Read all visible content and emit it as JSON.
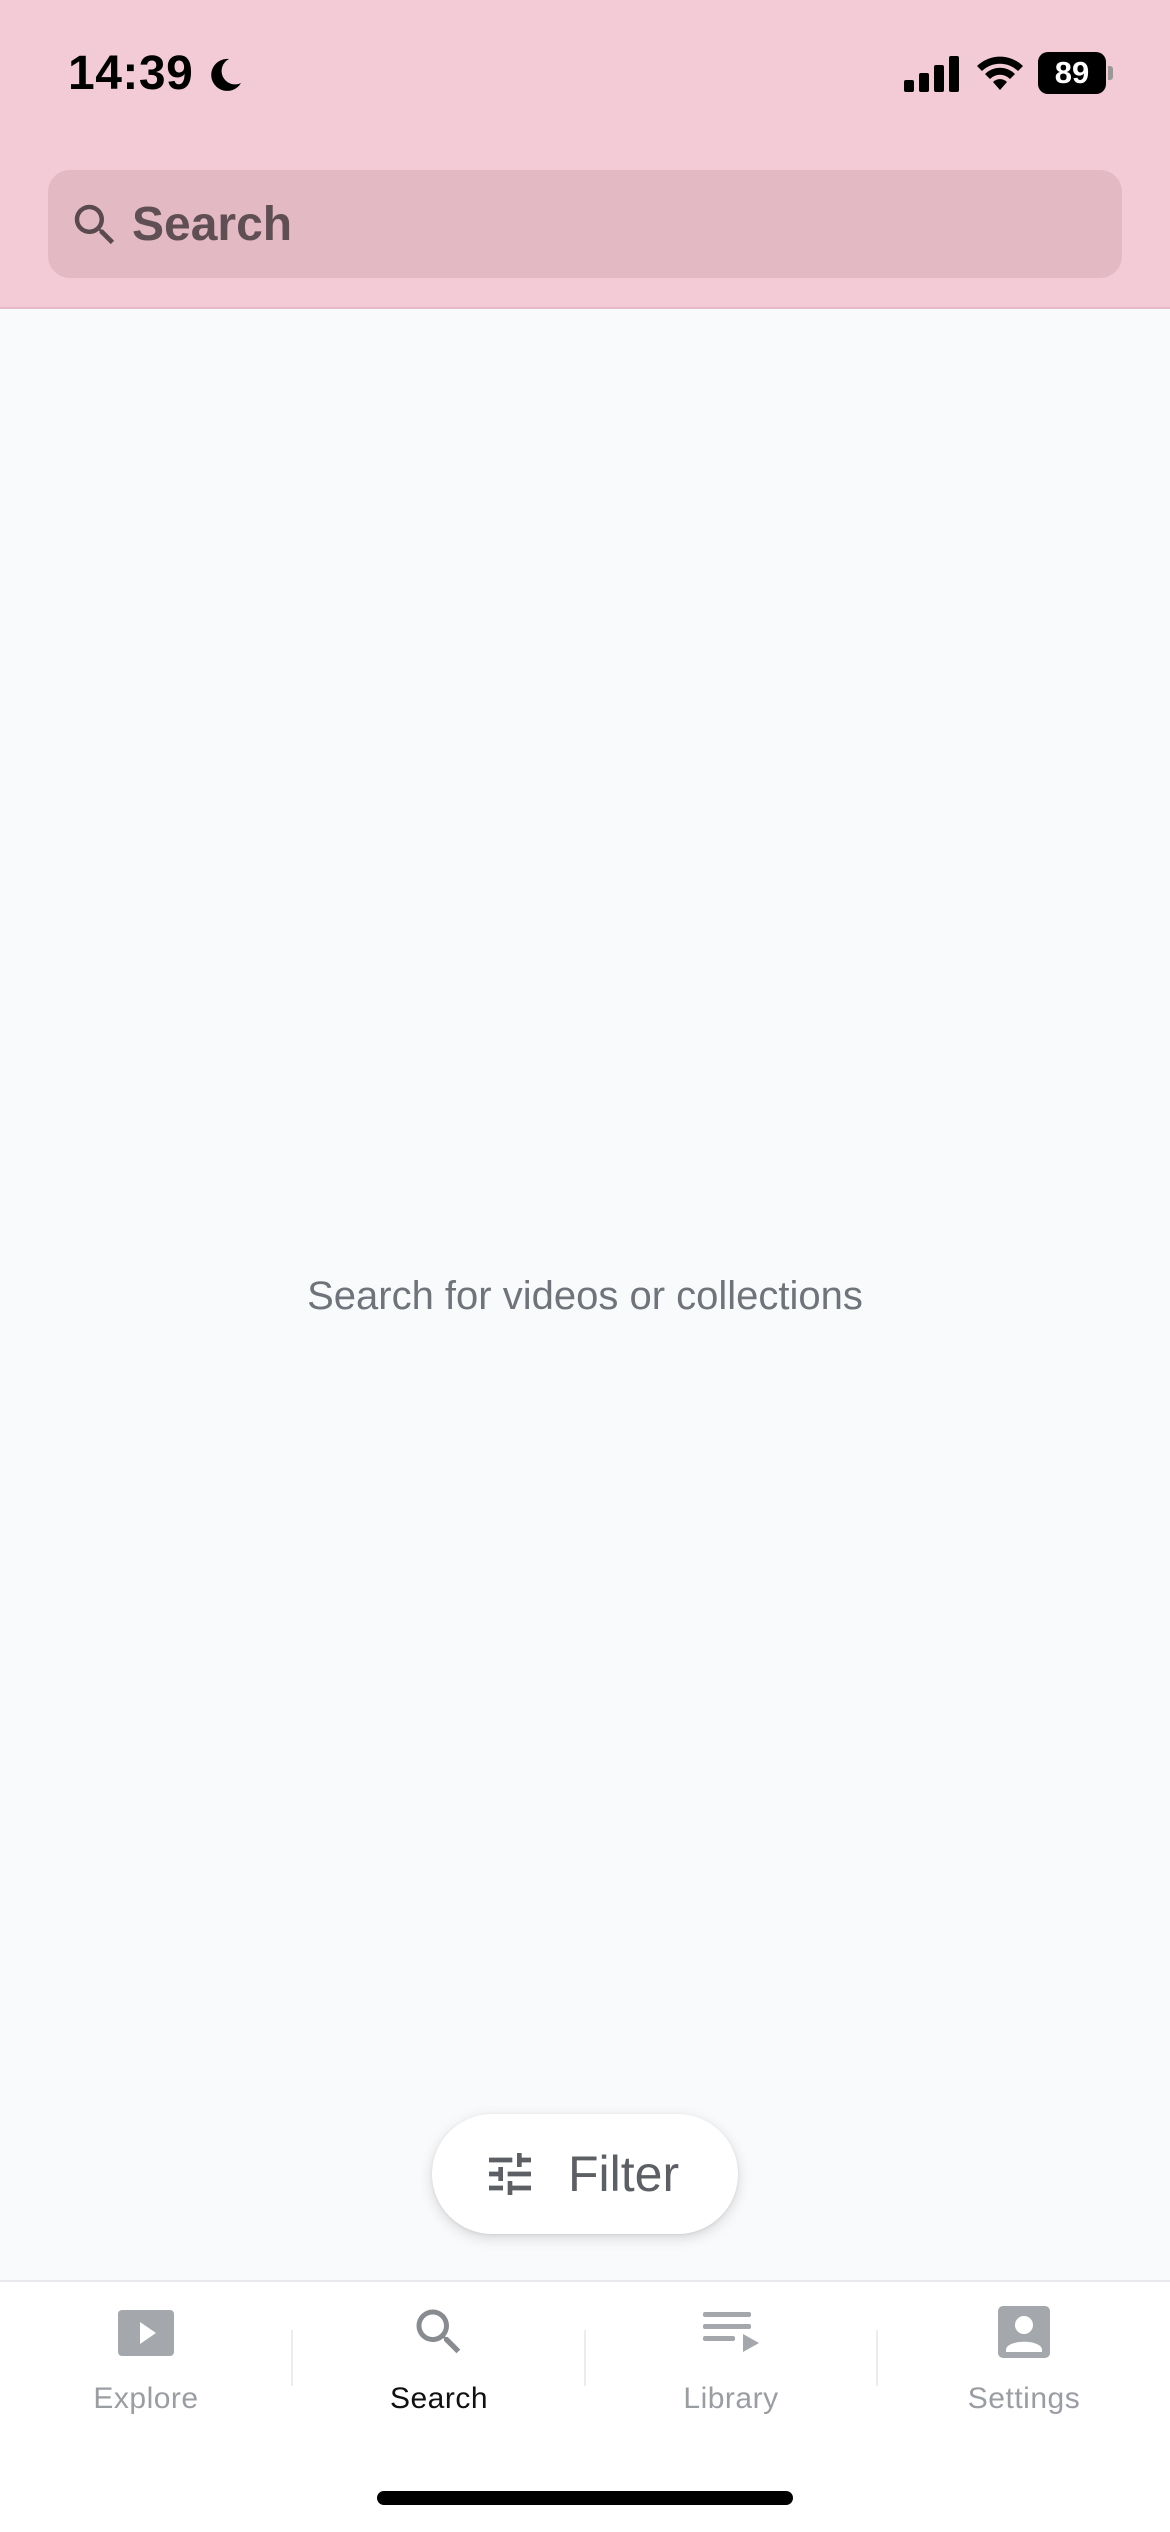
{
  "status_bar": {
    "time": "14:39",
    "battery": "89"
  },
  "search": {
    "placeholder": "Search"
  },
  "empty_state": {
    "message": "Search for videos or collections"
  },
  "filter": {
    "label": "Filter"
  },
  "tabs": [
    {
      "label": "Explore",
      "icon": "play-video-icon",
      "active": false
    },
    {
      "label": "Search",
      "icon": "search-icon",
      "active": true
    },
    {
      "label": "Library",
      "icon": "playlist-icon",
      "active": false
    },
    {
      "label": "Settings",
      "icon": "account-box-icon",
      "active": false
    }
  ],
  "colors": {
    "header": "#f2cbd6",
    "search_field": "#e3b9c3",
    "background": "#f9fafc",
    "tab_inactive": "#9a9da2",
    "tab_active": "#111111"
  }
}
